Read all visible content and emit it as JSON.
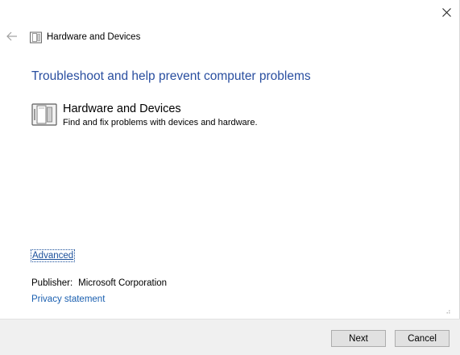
{
  "window": {
    "title": "Hardware and Devices",
    "close_icon": "close-icon",
    "back_icon": "back-arrow-icon"
  },
  "main": {
    "heading": "Troubleshoot and help prevent computer problems",
    "item": {
      "icon": "hardware-devices-icon",
      "name": "Hardware and Devices",
      "description": "Find and fix problems with devices and hardware."
    },
    "advanced_label": "Advanced",
    "publisher_label": "Publisher:",
    "publisher_value": "Microsoft Corporation",
    "privacy_label": "Privacy statement"
  },
  "footer": {
    "next_label": "Next",
    "cancel_label": "Cancel"
  },
  "colors": {
    "heading": "#2a4fa0",
    "link": "#1a5fb0",
    "footer_bg": "#f0f0f0"
  }
}
